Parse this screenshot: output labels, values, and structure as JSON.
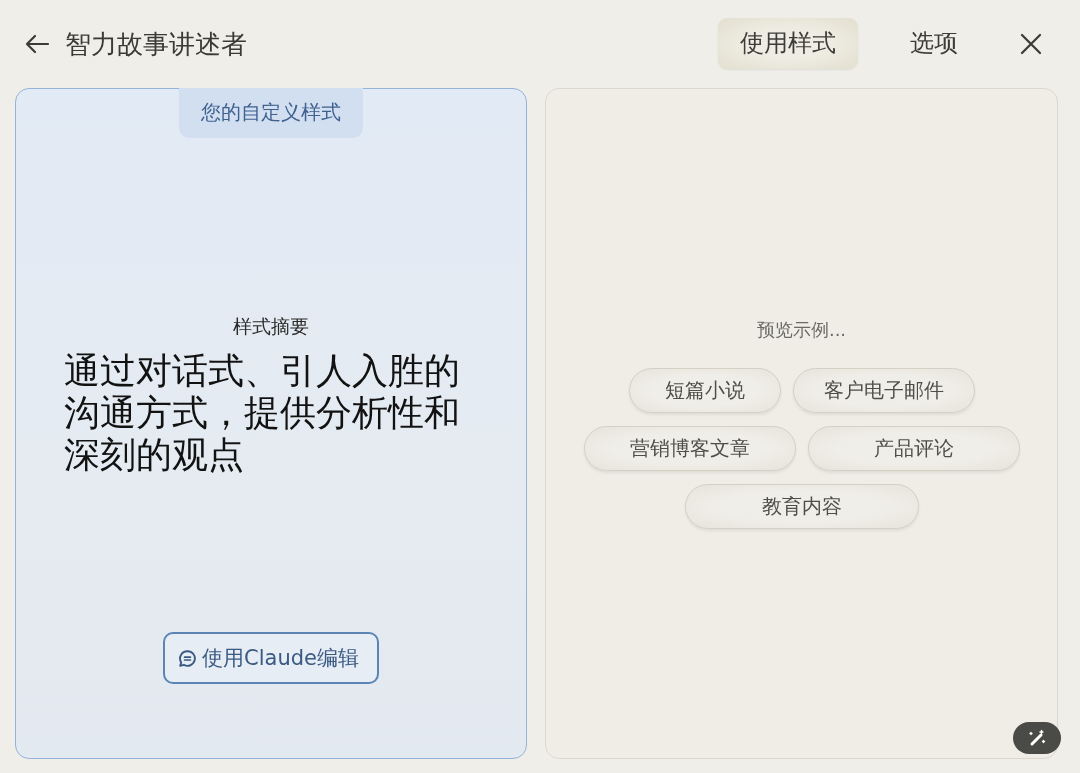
{
  "header": {
    "title": "智力故事讲述者",
    "tabs": [
      {
        "label": "使用样式",
        "selected": true
      },
      {
        "label": "选项",
        "selected": false
      }
    ]
  },
  "style_panel": {
    "badge": "您的自定义样式",
    "summary_label": "样式摘要",
    "summary": "通过对话式、引人入胜的沟通方式，提供分析性和深刻的观点",
    "edit_button": "使用Claude编辑"
  },
  "preview_panel": {
    "prompt": "预览示例...",
    "example_rows": [
      [
        "短篇小说",
        "客户电子邮件"
      ],
      [
        "营销博客文章",
        "产品评论"
      ],
      [
        "教育内容"
      ]
    ]
  }
}
